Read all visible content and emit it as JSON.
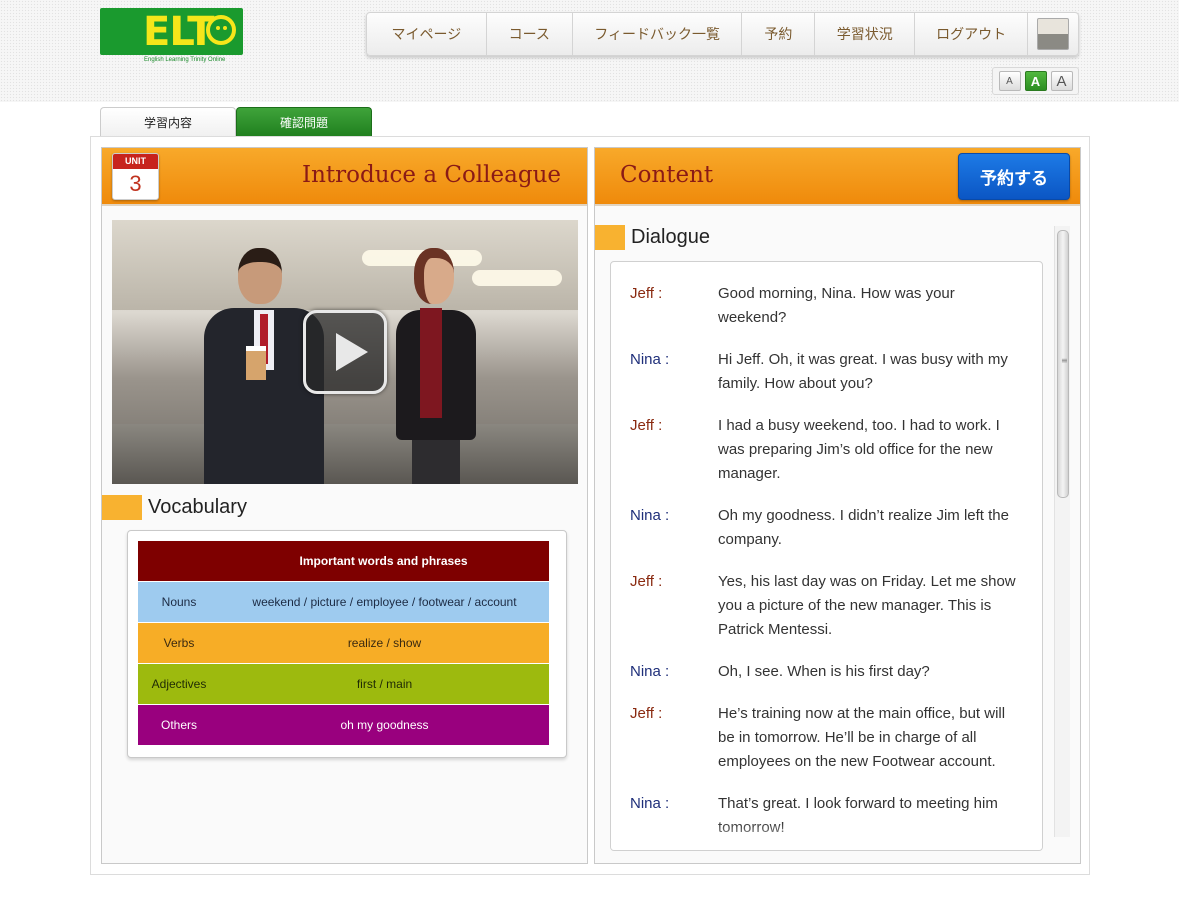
{
  "brand": {
    "logo_text": "ELT",
    "tagline": "English Learning Trinity Online"
  },
  "nav": {
    "items": [
      {
        "label": "マイページ"
      },
      {
        "label": "コース"
      },
      {
        "label": "フィードバック一覧"
      },
      {
        "label": "予約"
      },
      {
        "label": "学習状況"
      },
      {
        "label": "ログアウト"
      }
    ]
  },
  "font_size": {
    "small": "A",
    "medium": "A",
    "large": "A",
    "active_color": "#3aa02c"
  },
  "tabs": [
    {
      "label": "学習内容",
      "active": true
    },
    {
      "label": "確認問題",
      "active": false
    }
  ],
  "lesson": {
    "unit_label": "UNIT",
    "unit_number": "3",
    "title": "Introduce a Colleague",
    "video_icon": "play-icon"
  },
  "vocabulary": {
    "heading": "Vocabulary",
    "table_title": "Important words and phrases",
    "rows": [
      {
        "category": "Nouns",
        "words": "weekend / picture / employee / footwear / account",
        "color": "#9ecbef"
      },
      {
        "category": "Verbs",
        "words": "realize / show",
        "color": "#f7ad26"
      },
      {
        "category": "Adjectives",
        "words": "first / main",
        "color": "#9dba0e"
      },
      {
        "category": "Others",
        "words": "oh my goodness",
        "color": "#99007e"
      }
    ]
  },
  "content": {
    "title": "Content",
    "reserve_label": "予約する",
    "dialogue_heading": "Dialogue",
    "lines": [
      {
        "speaker": "Jeff :",
        "text": "Good morning, Nina. How was your weekend?"
      },
      {
        "speaker": "Nina :",
        "text": "Hi Jeff. Oh, it was great. I was busy with my family. How about you?"
      },
      {
        "speaker": "Jeff :",
        "text": "I had a busy weekend, too. I had to work. I was preparing Jim’s old office for the new manager."
      },
      {
        "speaker": "Nina :",
        "text": "Oh my goodness. I didn’t realize Jim left the company."
      },
      {
        "speaker": "Jeff :",
        "text": "Yes, his last day was on Friday. Let me show you a picture of the new manager. This is Patrick Mentessi."
      },
      {
        "speaker": "Nina :",
        "text": "Oh, I see. When is his first day?"
      },
      {
        "speaker": "Jeff :",
        "text": "He’s training now at the main office, but will be in tomorrow. He’ll be in charge of all employees on the new Footwear account."
      },
      {
        "speaker": "Nina :",
        "text": "That’s great. I look forward to meeting him tomorrow!"
      }
    ]
  },
  "colors": {
    "header_orange": "#f29412",
    "title_red": "#8a1a16",
    "reserve_blue": "#0b63d6",
    "tab_green": "#2a8f26",
    "jeff_color": "#8a2a10",
    "nina_color": "#1f2f7a"
  }
}
